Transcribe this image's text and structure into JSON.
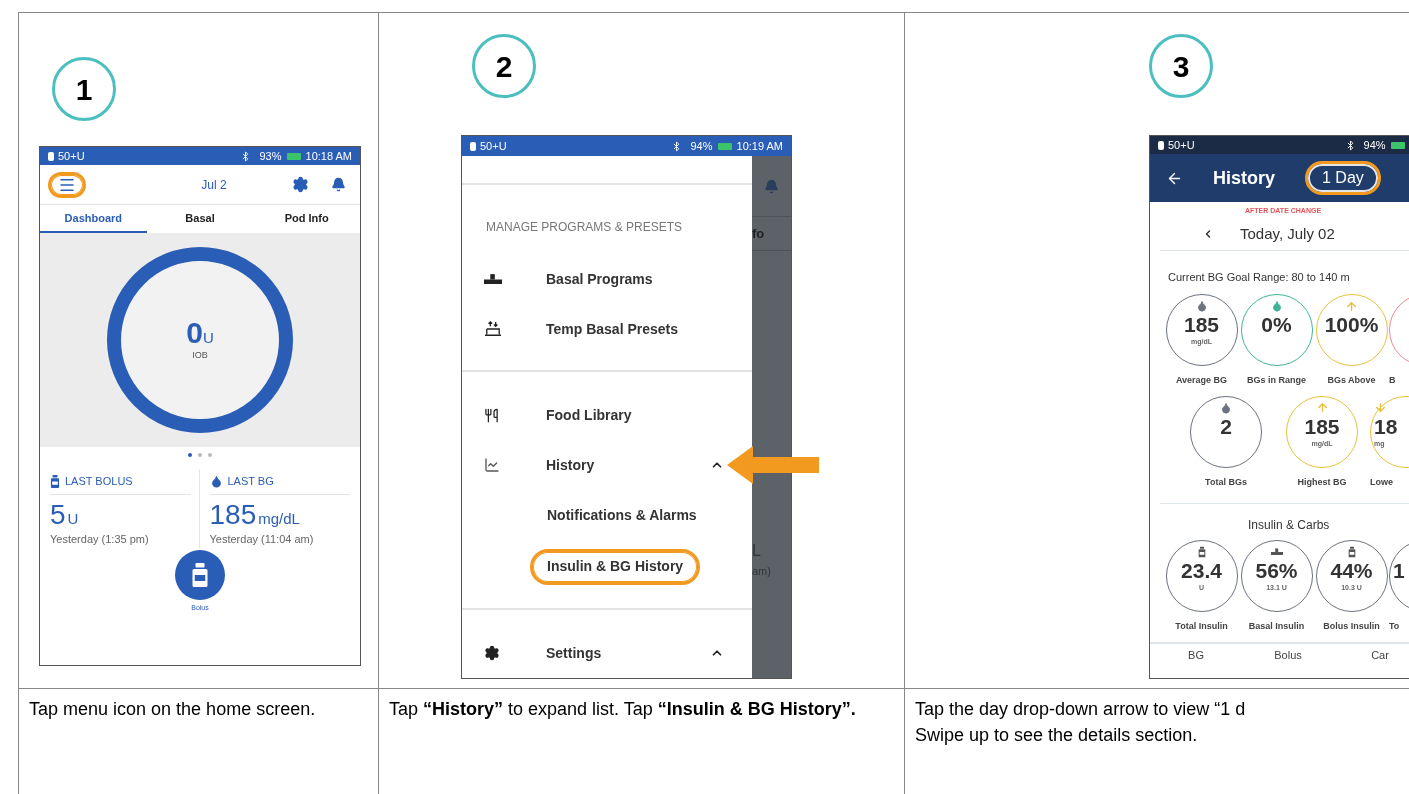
{
  "steps": [
    {
      "number": "1",
      "caption": [
        "Tap menu icon on the home screen."
      ],
      "screen": {
        "kind": "home",
        "status_bar": {
          "pod": "50+U",
          "battery": "93%",
          "time": "10:18 AM"
        },
        "date": "Jul 2",
        "menu_highlighted": true,
        "tabs": [
          {
            "label": "Dashboard",
            "selected": true
          },
          {
            "label": "Basal",
            "selected": false
          },
          {
            "label": "Pod Info",
            "selected": false
          }
        ],
        "iob": {
          "value": "0",
          "unit": "U",
          "label": "IOB"
        },
        "pager": [
          {
            "selected": true
          },
          {
            "selected": false
          },
          {
            "selected": false
          }
        ],
        "last_bolus": {
          "title": "LAST BOLUS",
          "value": "5",
          "unit": "U",
          "time": "Yesterday (1:35 pm)"
        },
        "last_bg": {
          "title": "LAST BG",
          "value": "185",
          "unit": "mg/dL",
          "time": "Yesterday (11:04 am)"
        },
        "bolus_button": "Bolus"
      }
    },
    {
      "number": "2",
      "caption": [
        "Tap **“History”** to expand list. Tap **“Insulin & BG History”.**"
      ],
      "screen": {
        "kind": "menu",
        "status_bar": {
          "pod": "50+U",
          "battery": "94%",
          "time": "10:19 AM"
        },
        "section_title": "MANAGE PROGRAMS & PRESETS",
        "groups": [
          [
            {
              "label": "Basal Programs",
              "kind": "basal"
            },
            {
              "label": "Temp Basal Presets",
              "kind": "temp"
            }
          ],
          [
            {
              "label": "Food Library",
              "kind": "food"
            },
            {
              "label": "History",
              "kind": "chart",
              "expanded": true,
              "pointed": true,
              "children": [
                {
                  "label": "Notifications & Alarms",
                  "highlighted": false
                },
                {
                  "label": "Insulin & BG History",
                  "highlighted": true
                }
              ]
            }
          ],
          [
            {
              "label": "Settings",
              "kind": "gear",
              "expanded": true
            }
          ]
        ],
        "background_texts": [
          "fo",
          "L",
          "am)"
        ]
      }
    },
    {
      "number": "3",
      "caption": [
        "Tap the day drop-down arrow to view “1 d",
        "Swipe up to see the details section."
      ],
      "screen": {
        "kind": "history",
        "status_bar": {
          "pod": "50+U",
          "battery": "94%"
        },
        "title": "History",
        "range_button": {
          "label": "1 Day",
          "highlighted": true
        },
        "note": "AFTER DATE CHANGE",
        "date": "Today, July 02",
        "goal_range": "Current BG Goal Range: 80 to 140 m",
        "bg_rows": [
          [
            {
              "kind": "drop",
              "color": "#6b7280",
              "value": "185",
              "unit": "mg/dL",
              "label": "Average BG"
            },
            {
              "kind": "drop",
              "color": "#3fb39a",
              "value": "0%",
              "label": "BGs in Range"
            },
            {
              "kind": "up",
              "color": "#e6c13b",
              "value": "100%",
              "label": "BGs Above"
            },
            {
              "kind": "none",
              "color": "#e58a92",
              "label": "B",
              "clipped": true
            }
          ],
          [
            {
              "kind": "drop",
              "color": "#6b7280",
              "value": "2",
              "label": "Total BGs"
            },
            {
              "kind": "up",
              "color": "#e6c13b",
              "value": "185",
              "unit": "mg/dL",
              "label": "Highest BG"
            },
            {
              "kind": "down",
              "color": "#e6c13b",
              "value": "18",
              "unit": "mg",
              "label": "Lowe",
              "clipped": true
            }
          ]
        ],
        "insulin_title": "Insulin & Carbs",
        "insulin_stats": [
          {
            "kind": "vial",
            "color": "#6b7280",
            "value": "23.4",
            "unit": "U",
            "label": "Total Insulin"
          },
          {
            "kind": "basal",
            "color": "#6b7280",
            "value": "56%",
            "unit": "13.1 U",
            "label": "Basal Insulin"
          },
          {
            "kind": "vial",
            "color": "#6b7280",
            "value": "44%",
            "unit": "10.3 U",
            "label": "Bolus Insulin"
          },
          {
            "kind": "none",
            "color": "#6b7280",
            "value": "1",
            "label": "To",
            "clipped": true
          }
        ],
        "bottom_tabs": [
          "BG",
          "Bolus",
          "Car"
        ]
      }
    }
  ]
}
